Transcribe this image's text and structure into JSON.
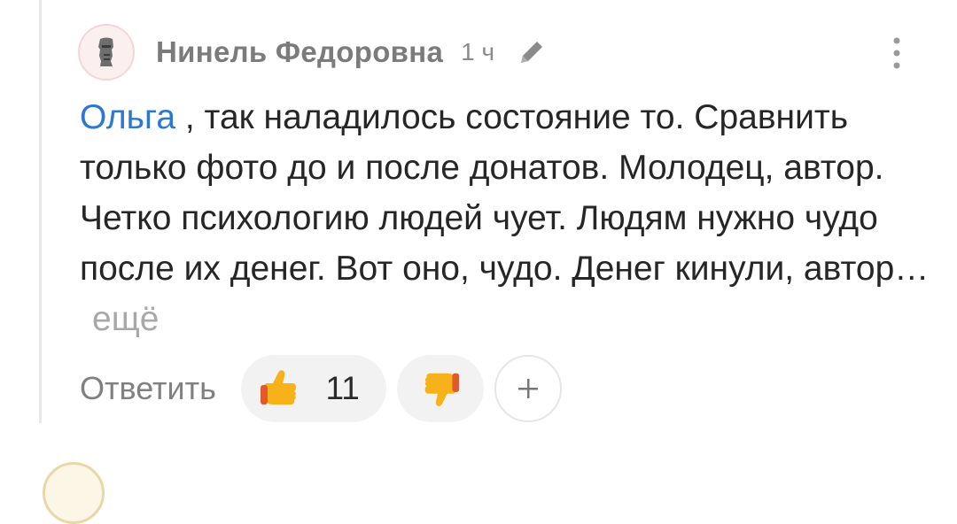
{
  "comment": {
    "author": "Нинель Федоровна",
    "time": "1 ч",
    "mention": "Ольга",
    "text": " , так наладилось состояние то. Сравнить только фото до и после донатов. Молодец, автор. Четко психологию людей чует. Людям нужно чудо после их денег. Вот оно, чудо. Денег кинули, автор…",
    "more_label": "ещё"
  },
  "actions": {
    "reply_label": "Ответить",
    "like_count": "11",
    "add_reaction_label": "+"
  },
  "colors": {
    "mention": "#2e76d6",
    "author": "#7b7b7b",
    "muted": "#a8a8a8",
    "pill_bg": "#f2f2f2",
    "thumb": "#f7b21a"
  },
  "icons": {
    "avatar": "moai-statue-icon",
    "edit": "pencil-icon",
    "menu": "vertical-dots-icon",
    "like": "thumbs-up-icon",
    "dislike": "thumbs-down-icon",
    "add_reaction": "plus-icon"
  }
}
